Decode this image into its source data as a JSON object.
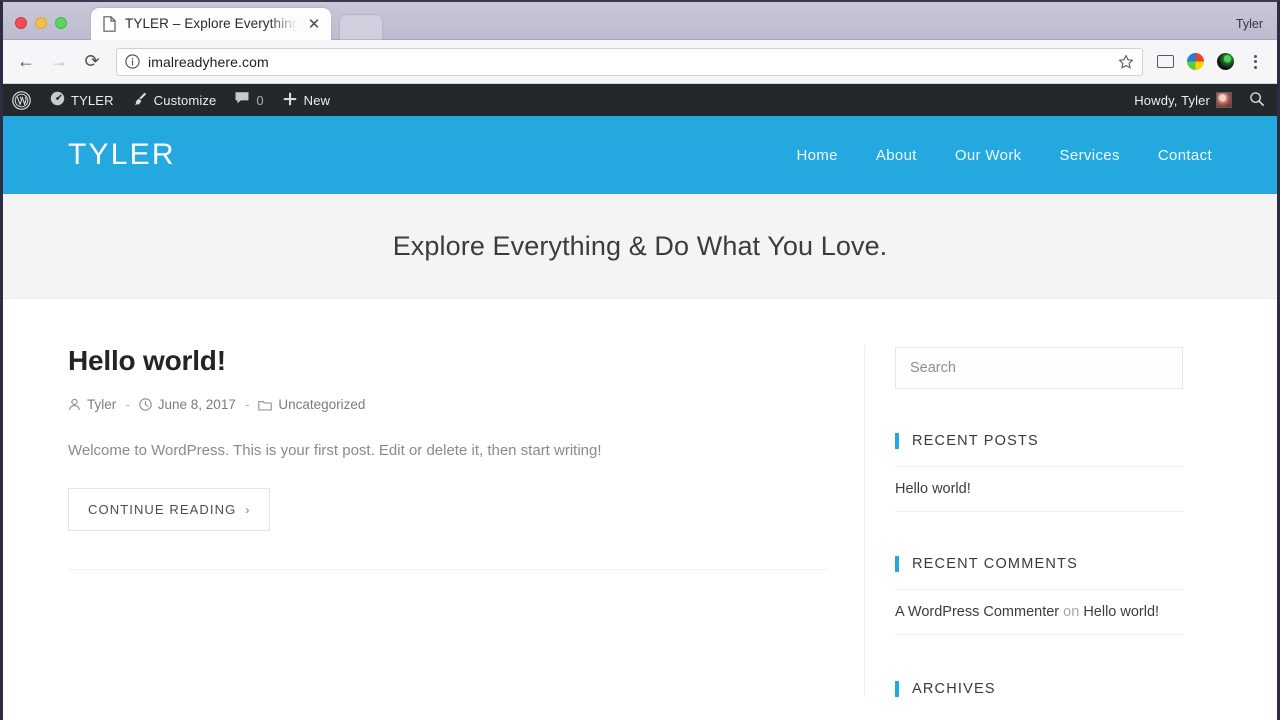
{
  "browser": {
    "profile_name": "Tyler",
    "tab": {
      "title": "TYLER – Explore Everything &",
      "favicon": "page-icon",
      "close": "✕"
    },
    "nav": {
      "back": "←",
      "forward": "→",
      "reload": "⟳"
    },
    "omnibox": {
      "url": "imalreadyhere.com",
      "info_icon": "info-circle-icon",
      "star_icon": "★"
    },
    "toolbar_icons": [
      "cast-icon",
      "pinwheel-extension-icon",
      "dark-orb-extension-icon",
      "kebab-menu-icon"
    ]
  },
  "adminbar": {
    "logo": "wordpress-logo-icon",
    "site_name": "TYLER",
    "site_icon": "dashboard-icon",
    "customize": "Customize",
    "customize_icon": "paintbrush-icon",
    "comments_count": "0",
    "comments_icon": "comment-bubble-icon",
    "new": "New",
    "new_icon": "plus-icon",
    "howdy": "Howdy, Tyler",
    "avatar": "user-avatar",
    "search_icon": "search-icon"
  },
  "site": {
    "title": "TYLER",
    "accent_color": "#23a8e0",
    "nav": [
      {
        "label": "Home"
      },
      {
        "label": "About"
      },
      {
        "label": "Our Work"
      },
      {
        "label": "Services"
      },
      {
        "label": "Contact"
      }
    ],
    "tagline": "Explore Everything & Do What You Love."
  },
  "post": {
    "title": "Hello world!",
    "author": "Tyler",
    "author_icon": "person-icon",
    "date": "June 8, 2017",
    "date_icon": "clock-icon",
    "category": "Uncategorized",
    "category_icon": "folder-icon",
    "separator": "-",
    "excerpt": "Welcome to WordPress. This is your first post. Edit or delete it, then start writing!",
    "continue_label": "CONTINUE READING",
    "continue_chevron": "›"
  },
  "sidebar": {
    "search": {
      "placeholder": "Search",
      "value": ""
    },
    "widgets": [
      {
        "title": "RECENT POSTS",
        "items": [
          {
            "text": "Hello world!"
          }
        ]
      },
      {
        "title": "RECENT COMMENTS",
        "items": [
          {
            "commenter": "A WordPress Commenter",
            "on": "on",
            "post": "Hello world!"
          }
        ]
      },
      {
        "title": "ARCHIVES",
        "items": []
      }
    ]
  }
}
